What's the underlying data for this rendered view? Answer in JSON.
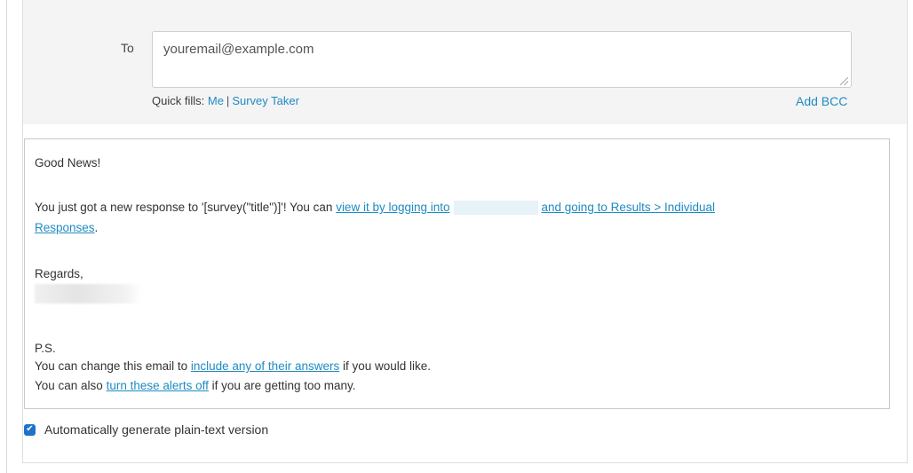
{
  "recipients": {
    "to_label": "To",
    "to_value": "youremail@example.com",
    "quick_fills_label": "Quick fills:",
    "quick_fills": [
      "Me",
      "Survey Taker"
    ],
    "quick_fills_separator": "|",
    "add_bcc": "Add BCC"
  },
  "body": {
    "greeting": "Good News!",
    "line1_prefix": "You just got a new response to '[survey(\"title\")]'! You can ",
    "line1_link_a": "view it by logging into",
    "line1_link_b": "and going to Results > Individual",
    "line1_link_c": "Responses",
    "line1_suffix": ".",
    "regards": "Regards,",
    "ps": "P.S.",
    "ps1_prefix": "You can change this email to ",
    "ps1_link": "include any of their answers",
    "ps1_suffix": " if you would like.",
    "ps2_prefix": "You can also ",
    "ps2_link": "turn these alerts off",
    "ps2_suffix": " if you are getting too many."
  },
  "options": {
    "auto_plaintext_label": "Automatically generate plain-text version",
    "auto_plaintext_checked": true
  },
  "colors": {
    "link": "#1e8bc3",
    "checkbox": "#1e73c9",
    "header_bg": "#f4f4f4"
  }
}
